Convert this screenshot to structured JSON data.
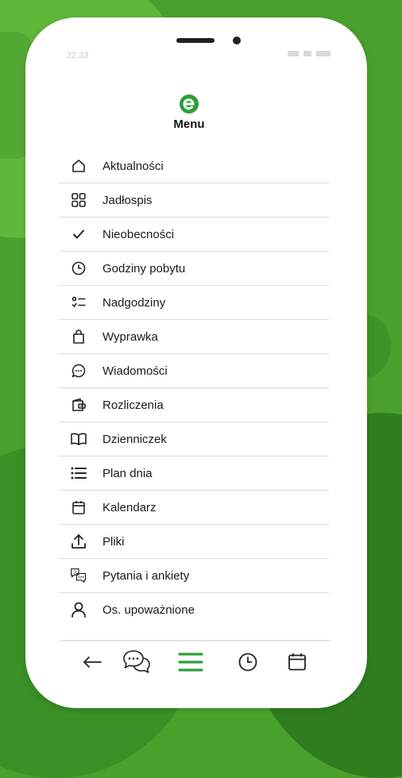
{
  "status_bar": {
    "time": "22:33"
  },
  "header": {
    "title": "Menu",
    "logo_icon": "app-logo-icon",
    "brand_color": "#2e9e3a"
  },
  "menu": {
    "items": [
      {
        "label": "Aktualności",
        "icon": "home-icon"
      },
      {
        "label": "Jadłospis",
        "icon": "grid-icon"
      },
      {
        "label": "Nieobecności",
        "icon": "check-icon"
      },
      {
        "label": "Godziny pobytu",
        "icon": "clock-icon"
      },
      {
        "label": "Nadgodziny",
        "icon": "checklist-icon"
      },
      {
        "label": "Wyprawka",
        "icon": "bag-icon"
      },
      {
        "label": "Wiadomości",
        "icon": "chat-bubble-icon"
      },
      {
        "label": "Rozliczenia",
        "icon": "wallet-icon"
      },
      {
        "label": "Dzienniczek",
        "icon": "book-icon"
      },
      {
        "label": "Plan dnia",
        "icon": "list-icon"
      },
      {
        "label": "Kalendarz",
        "icon": "calendar-icon"
      },
      {
        "label": "Pliki",
        "icon": "upload-icon"
      },
      {
        "label": "Pytania i ankiety",
        "icon": "question-chat-icon"
      },
      {
        "label": "Os. upoważnione",
        "icon": "person-icon"
      }
    ]
  },
  "bottom_nav": {
    "items": [
      {
        "name": "back",
        "icon": "back-arrow-icon"
      },
      {
        "name": "messages",
        "icon": "chat-icon"
      },
      {
        "name": "menu",
        "icon": "menu-icon",
        "active": true,
        "color": "#2e9e3a"
      },
      {
        "name": "hours",
        "icon": "clock-icon"
      },
      {
        "name": "calendar",
        "icon": "calendar-icon"
      }
    ]
  }
}
